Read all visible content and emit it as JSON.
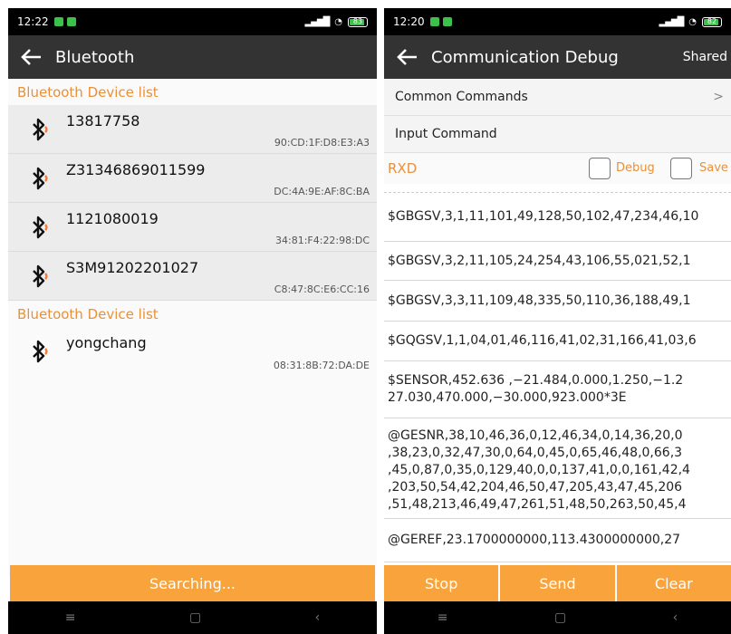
{
  "left": {
    "status": {
      "time": "12:22",
      "battery": "83"
    },
    "appbar": {
      "title": "Bluetooth"
    },
    "paired_header": "Bluetooth Device list",
    "paired": [
      {
        "name": "13817758",
        "mac": "90:CD:1F:D8:E3:A3"
      },
      {
        "name": "Z31346869011599",
        "mac": "DC:4A:9E:AF:8C:BA"
      },
      {
        "name": "1121080019",
        "mac": "34:81:F4:22:98:DC"
      },
      {
        "name": "S3M91202201027",
        "mac": "C8:47:8C:E6:CC:16"
      }
    ],
    "available_header": "Bluetooth Device list",
    "available": [
      {
        "name": "yongchang",
        "mac": "08:31:8B:72:DA:DE"
      }
    ],
    "search_button": "Searching...",
    "nav": {
      "menu": "≡",
      "home": "▢",
      "back": "‹"
    }
  },
  "right": {
    "status": {
      "time": "12:20",
      "battery": "82"
    },
    "appbar": {
      "title": "Communication Debug",
      "action": "Shared"
    },
    "common_commands": "Common Commands",
    "common_chevron": ">",
    "input_command": "Input Command",
    "rxd_label": "RXD",
    "debug_label": "Debug",
    "save_label": "Save",
    "rx_lines": [
      [
        "$GBGSV,3,1,11,101,49,128,50,102,47,234,46,10"
      ],
      [
        "$GBGSV,3,2,11,105,24,254,43,106,55,021,52,1"
      ],
      [
        "$GBGSV,3,3,11,109,48,335,50,110,36,188,49,1"
      ],
      [
        "$GQGSV,1,1,04,01,46,116,41,02,31,166,41,03,6"
      ],
      [
        "$SENSOR,452.636 ,−21.484,0.000,1.250,−1.2",
        "27.030,470.000,−30.000,923.000*3E"
      ],
      [
        "@GESNR,38,10,46,36,0,12,46,34,0,14,36,20,0",
        ",38,23,0,32,47,30,0,64,0,45,0,65,46,48,0,66,3",
        ",45,0,87,0,35,0,129,40,0,0,137,41,0,0,161,42,4",
        ",203,50,54,42,204,46,50,47,205,43,47,45,206",
        ",51,48,213,46,49,47,261,51,48,50,263,50,45,4"
      ],
      [
        "@GEREF,23.1700000000,113.4300000000,27"
      ]
    ],
    "buttons": {
      "stop": "Stop",
      "send": "Send",
      "clear": "Clear"
    },
    "nav": {
      "menu": "≡",
      "home": "▢",
      "back": "‹"
    }
  },
  "colors": {
    "accent": "#f8a33c",
    "header_text": "#e8913a",
    "appbar": "#333333"
  },
  "icons": {
    "device": "bluetooth-icon",
    "back": "arrow-left-icon"
  }
}
